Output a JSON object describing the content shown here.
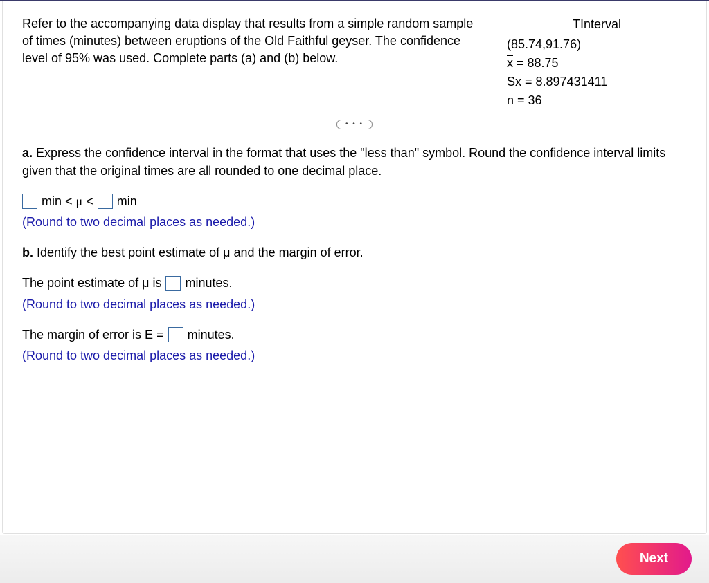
{
  "question": {
    "intro": "Refer to the accompanying data display that results from a simple random sample of times (minutes) between eruptions of the Old Faithful geyser. The confidence level of 95% was used. Complete parts (a) and (b) below.",
    "data_display": {
      "title": "TInterval",
      "interval": "(85.74,91.76)",
      "xbar": "x = 88.75",
      "sx": "Sx = 8.897431411",
      "n": "n = 36"
    }
  },
  "more_button": "• • •",
  "parts": {
    "a": {
      "label": "a.",
      "text": " Express the confidence interval in the format that uses the \"less than\" symbol. Round the confidence interval limits given that the original times are all rounded to one decimal place.",
      "unit1": "min < ",
      "mu": "μ",
      "lt": " < ",
      "unit2": "min",
      "hint": "(Round to two decimal places as needed.)"
    },
    "b": {
      "label": "b.",
      "text": " Identify the best point estimate of μ and the margin of error.",
      "point_estimate_pre": "The point estimate of μ is ",
      "point_estimate_post": " minutes.",
      "hint1": "(Round to two decimal places as needed.)",
      "margin_pre": "The margin of error is E = ",
      "margin_post": " minutes.",
      "hint2": "(Round to two decimal places as needed.)"
    }
  },
  "footer": {
    "next": "Next"
  }
}
